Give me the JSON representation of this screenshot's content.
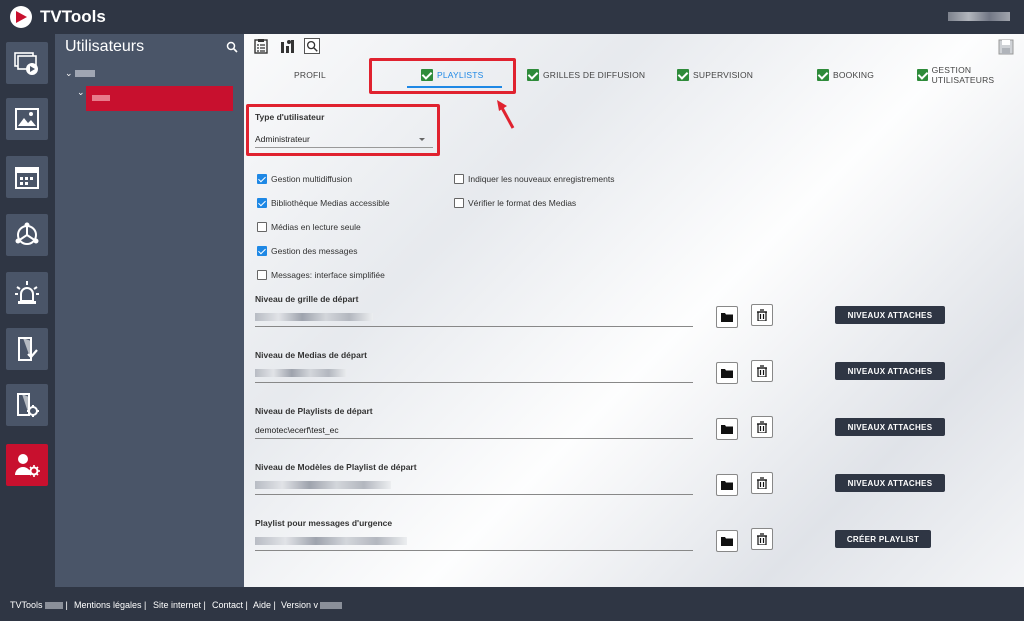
{
  "app": {
    "title": "TVTools"
  },
  "rail": {
    "items": [
      {
        "name": "playlists",
        "icon": "playlist-screens-icon"
      },
      {
        "name": "media",
        "icon": "image-icon"
      },
      {
        "name": "schedule",
        "icon": "calendar-icon"
      },
      {
        "name": "broadcast",
        "icon": "network-icon"
      },
      {
        "name": "alerts",
        "icon": "alarm-icon"
      },
      {
        "name": "approval",
        "icon": "document-check-icon"
      },
      {
        "name": "settings",
        "icon": "document-gear-icon"
      },
      {
        "name": "users",
        "icon": "user-gear-icon",
        "active": true
      }
    ]
  },
  "sidebar": {
    "title": "Utilisateurs"
  },
  "tabs": [
    {
      "label": "PROFIL",
      "checked": false
    },
    {
      "label": "PLAYLISTS",
      "checked": true,
      "active": true
    },
    {
      "label": "GRILLES DE DIFFUSION",
      "checked": true
    },
    {
      "label": "SUPERVISION",
      "checked": true
    },
    {
      "label": "BOOKING",
      "checked": true
    },
    {
      "label": "GESTION UTILISATEURS",
      "checked": true
    }
  ],
  "user_type": {
    "label": "Type d'utilisateur",
    "value": "Administrateur"
  },
  "checkboxes_left": [
    {
      "label": "Gestion multidiffusion",
      "checked": true
    },
    {
      "label": "Bibliothèque Medias accessible",
      "checked": true
    },
    {
      "label": "Médias en lecture seule",
      "checked": false
    },
    {
      "label": "Gestion des messages",
      "checked": true
    },
    {
      "label": "Messages: interface simplifiée",
      "checked": false
    }
  ],
  "checkboxes_right": [
    {
      "label": "Indiquer les nouveaux enregistrements",
      "checked": false
    },
    {
      "label": "Vérifier le format des Medias",
      "checked": false
    }
  ],
  "levels": [
    {
      "label": "Niveau de grille de départ",
      "value": "",
      "button": "NIVEAUX ATTACHES"
    },
    {
      "label": "Niveau de Medias de départ",
      "value": "",
      "button": "NIVEAUX ATTACHES"
    },
    {
      "label": "Niveau de Playlists de départ",
      "value": "demotec\\ecerf\\test_ec",
      "button": "NIVEAUX ATTACHES"
    },
    {
      "label": "Niveau de Modèles de Playlist de départ",
      "value": "",
      "button": "NIVEAUX ATTACHES"
    },
    {
      "label": "Playlist pour messages d'urgence",
      "value": "",
      "button": "CRÉER PLAYLIST"
    }
  ],
  "footer": {
    "brand": "TVTools",
    "links": [
      "Mentions légales",
      "Site internet",
      "Contact",
      "Aide",
      "Version v"
    ]
  },
  "colors": {
    "accent": "#c8102e",
    "tab_active": "#1e88e5",
    "check_green": "#2e8b3a",
    "annotation_red": "#e0222f",
    "dark": "#2f3644"
  }
}
